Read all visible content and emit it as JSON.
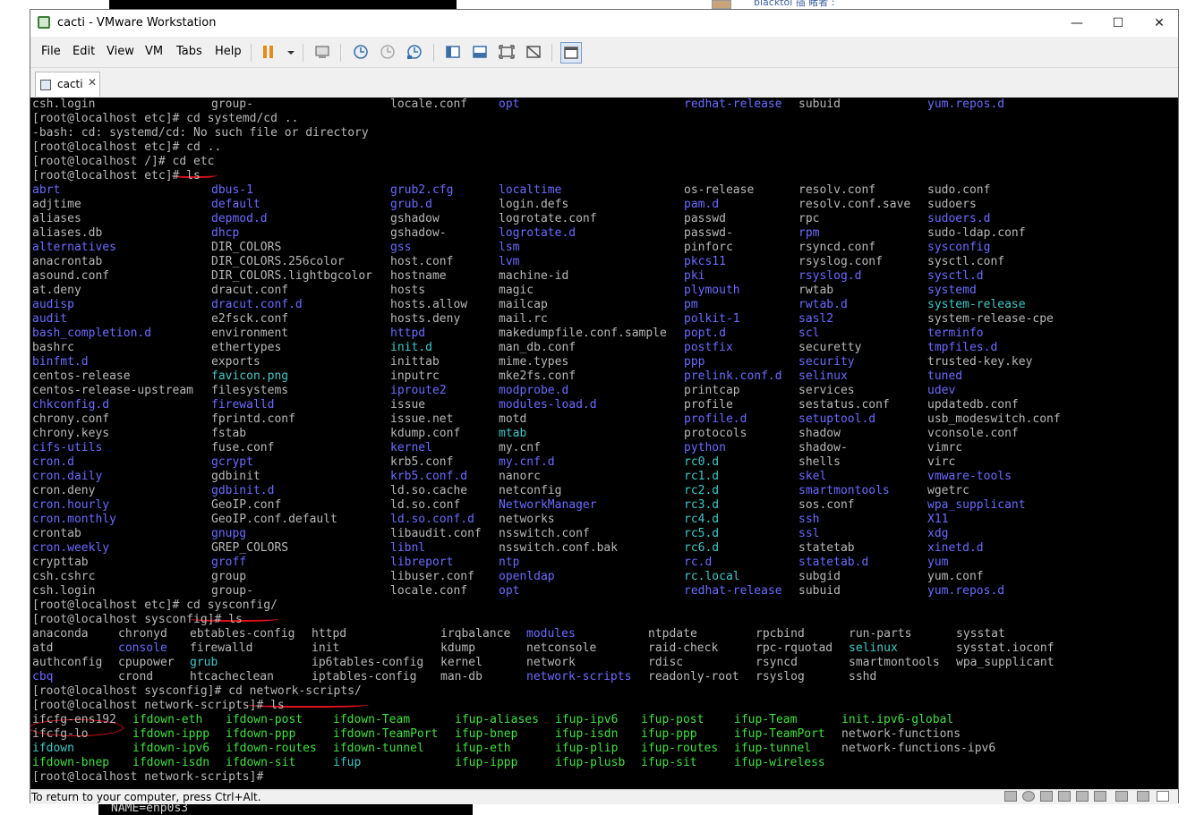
{
  "window": {
    "title": "cacti - VMware Workstation"
  },
  "background": {
    "bottom_text": "NAME=enp0s3",
    "top_text": "blacktol 插 睹者 :"
  },
  "menu": [
    "File",
    "Edit",
    "View",
    "VM",
    "Tabs",
    "Help"
  ],
  "toolbar": [
    "pause-icon",
    "dropdown-icon",
    "send-ctrl-alt-del-icon",
    "snapshot-take-icon",
    "snapshot-revert-icon",
    "snapshot-manager-icon",
    "library-icon",
    "console-view-icon",
    "fullscreen-icon",
    "unity-icon",
    "thumbnail-icon"
  ],
  "tab": {
    "label": "cacti"
  },
  "status": {
    "message": "To return to your computer, press Ctrl+Alt."
  },
  "colors": {
    "normal": "#b8b8b8",
    "dir": "#6b6bff",
    "exec": "#40e040",
    "link": "#40c8c8"
  },
  "terminal": {
    "col_pos1": [
      0,
      200,
      400,
      521,
      728,
      856,
      1000
    ],
    "row1": [
      [
        "csh.login",
        "n"
      ],
      [
        "group-",
        "n"
      ],
      [
        "locale.conf",
        "n"
      ],
      [
        "opt",
        "d"
      ],
      [
        "redhat-release",
        "d"
      ],
      [
        "subuid",
        "n"
      ],
      [
        "yum.repos.d",
        "d"
      ]
    ],
    "cmd1": [
      "[root@localhost etc]# cd systemd/cd ..",
      "-bash: cd: systemd/cd: No such file or directory",
      "[root@localhost etc]# cd ..",
      "[root@localhost /]# cd etc",
      "[root@localhost etc]# ls"
    ],
    "etc_rows": [
      [
        [
          "abrt",
          "d"
        ],
        [
          "dbus-1",
          "d"
        ],
        [
          "grub2.cfg",
          "d"
        ],
        [
          "localtime",
          "d"
        ],
        [
          "os-release",
          "n"
        ],
        [
          "resolv.conf",
          "n"
        ],
        [
          "sudo.conf",
          "n"
        ]
      ],
      [
        [
          "adjtime",
          "n"
        ],
        [
          "default",
          "d"
        ],
        [
          "grub.d",
          "d"
        ],
        [
          "login.defs",
          "n"
        ],
        [
          "pam.d",
          "d"
        ],
        [
          "resolv.conf.save",
          "n"
        ],
        [
          "sudoers",
          "n"
        ]
      ],
      [
        [
          "aliases",
          "n"
        ],
        [
          "depmod.d",
          "d"
        ],
        [
          "gshadow",
          "n"
        ],
        [
          "logrotate.conf",
          "n"
        ],
        [
          "passwd",
          "n"
        ],
        [
          "rpc",
          "n"
        ],
        [
          "sudoers.d",
          "d"
        ]
      ],
      [
        [
          "aliases.db",
          "n"
        ],
        [
          "dhcp",
          "d"
        ],
        [
          "gshadow-",
          "n"
        ],
        [
          "logrotate.d",
          "d"
        ],
        [
          "passwd-",
          "n"
        ],
        [
          "rpm",
          "d"
        ],
        [
          "sudo-ldap.conf",
          "n"
        ]
      ],
      [
        [
          "alternatives",
          "d"
        ],
        [
          "DIR_COLORS",
          "n"
        ],
        [
          "gss",
          "d"
        ],
        [
          "lsm",
          "d"
        ],
        [
          "pinforc",
          "n"
        ],
        [
          "rsyncd.conf",
          "n"
        ],
        [
          "sysconfig",
          "d"
        ]
      ],
      [
        [
          "anacrontab",
          "n"
        ],
        [
          "DIR_COLORS.256color",
          "n"
        ],
        [
          "host.conf",
          "n"
        ],
        [
          "lvm",
          "d"
        ],
        [
          "pkcs11",
          "d"
        ],
        [
          "rsyslog.conf",
          "n"
        ],
        [
          "sysctl.conf",
          "n"
        ]
      ],
      [
        [
          "asound.conf",
          "n"
        ],
        [
          "DIR_COLORS.lightbgcolor",
          "n"
        ],
        [
          "hostname",
          "n"
        ],
        [
          "machine-id",
          "n"
        ],
        [
          "pki",
          "d"
        ],
        [
          "rsyslog.d",
          "d"
        ],
        [
          "sysctl.d",
          "d"
        ]
      ],
      [
        [
          "at.deny",
          "n"
        ],
        [
          "dracut.conf",
          "n"
        ],
        [
          "hosts",
          "n"
        ],
        [
          "magic",
          "n"
        ],
        [
          "plymouth",
          "d"
        ],
        [
          "rwtab",
          "n"
        ],
        [
          "systemd",
          "d"
        ]
      ],
      [
        [
          "audisp",
          "d"
        ],
        [
          "dracut.conf.d",
          "d"
        ],
        [
          "hosts.allow",
          "n"
        ],
        [
          "mailcap",
          "n"
        ],
        [
          "pm",
          "d"
        ],
        [
          "rwtab.d",
          "d"
        ],
        [
          "system-release",
          "l"
        ]
      ],
      [
        [
          "audit",
          "d"
        ],
        [
          "e2fsck.conf",
          "n"
        ],
        [
          "hosts.deny",
          "n"
        ],
        [
          "mail.rc",
          "n"
        ],
        [
          "polkit-1",
          "d"
        ],
        [
          "sasl2",
          "d"
        ],
        [
          "system-release-cpe",
          "n"
        ]
      ],
      [
        [
          "bash_completion.d",
          "d"
        ],
        [
          "environment",
          "n"
        ],
        [
          "httpd",
          "d"
        ],
        [
          "makedumpfile.conf.sample",
          "n"
        ],
        [
          "popt.d",
          "d"
        ],
        [
          "scl",
          "d"
        ],
        [
          "terminfo",
          "d"
        ]
      ],
      [
        [
          "bashrc",
          "n"
        ],
        [
          "ethertypes",
          "n"
        ],
        [
          "init.d",
          "l"
        ],
        [
          "man_db.conf",
          "n"
        ],
        [
          "postfix",
          "d"
        ],
        [
          "securetty",
          "n"
        ],
        [
          "tmpfiles.d",
          "d"
        ]
      ],
      [
        [
          "binfmt.d",
          "d"
        ],
        [
          "exports",
          "n"
        ],
        [
          "inittab",
          "n"
        ],
        [
          "mime.types",
          "n"
        ],
        [
          "ppp",
          "d"
        ],
        [
          "security",
          "d"
        ],
        [
          "trusted-key.key",
          "n"
        ]
      ],
      [
        [
          "centos-release",
          "n"
        ],
        [
          "favicon.png",
          "l"
        ],
        [
          "inputrc",
          "n"
        ],
        [
          "mke2fs.conf",
          "n"
        ],
        [
          "prelink.conf.d",
          "d"
        ],
        [
          "selinux",
          "d"
        ],
        [
          "tuned",
          "d"
        ]
      ],
      [
        [
          "centos-release-upstream",
          "n"
        ],
        [
          "filesystems",
          "n"
        ],
        [
          "iproute2",
          "d"
        ],
        [
          "modprobe.d",
          "d"
        ],
        [
          "printcap",
          "n"
        ],
        [
          "services",
          "n"
        ],
        [
          "udev",
          "d"
        ]
      ],
      [
        [
          "chkconfig.d",
          "d"
        ],
        [
          "firewalld",
          "d"
        ],
        [
          "issue",
          "n"
        ],
        [
          "modules-load.d",
          "d"
        ],
        [
          "profile",
          "n"
        ],
        [
          "sestatus.conf",
          "n"
        ],
        [
          "updatedb.conf",
          "n"
        ]
      ],
      [
        [
          "chrony.conf",
          "n"
        ],
        [
          "fprintd.conf",
          "n"
        ],
        [
          "issue.net",
          "n"
        ],
        [
          "motd",
          "n"
        ],
        [
          "profile.d",
          "d"
        ],
        [
          "setuptool.d",
          "d"
        ],
        [
          "usb_modeswitch.conf",
          "n"
        ]
      ],
      [
        [
          "chrony.keys",
          "n"
        ],
        [
          "fstab",
          "n"
        ],
        [
          "kdump.conf",
          "n"
        ],
        [
          "mtab",
          "l"
        ],
        [
          "protocols",
          "n"
        ],
        [
          "shadow",
          "n"
        ],
        [
          "vconsole.conf",
          "n"
        ]
      ],
      [
        [
          "cifs-utils",
          "d"
        ],
        [
          "fuse.conf",
          "n"
        ],
        [
          "kernel",
          "d"
        ],
        [
          "my.cnf",
          "n"
        ],
        [
          "python",
          "d"
        ],
        [
          "shadow-",
          "n"
        ],
        [
          "vimrc",
          "n"
        ]
      ],
      [
        [
          "cron.d",
          "d"
        ],
        [
          "gcrypt",
          "d"
        ],
        [
          "krb5.conf",
          "n"
        ],
        [
          "my.cnf.d",
          "d"
        ],
        [
          "rc0.d",
          "l"
        ],
        [
          "shells",
          "n"
        ],
        [
          "virc",
          "n"
        ]
      ],
      [
        [
          "cron.daily",
          "d"
        ],
        [
          "gdbinit",
          "n"
        ],
        [
          "krb5.conf.d",
          "d"
        ],
        [
          "nanorc",
          "n"
        ],
        [
          "rc1.d",
          "l"
        ],
        [
          "skel",
          "d"
        ],
        [
          "vmware-tools",
          "d"
        ]
      ],
      [
        [
          "cron.deny",
          "n"
        ],
        [
          "gdbinit.d",
          "d"
        ],
        [
          "ld.so.cache",
          "n"
        ],
        [
          "netconfig",
          "n"
        ],
        [
          "rc2.d",
          "l"
        ],
        [
          "smartmontools",
          "d"
        ],
        [
          "wgetrc",
          "n"
        ]
      ],
      [
        [
          "cron.hourly",
          "d"
        ],
        [
          "GeoIP.conf",
          "n"
        ],
        [
          "ld.so.conf",
          "n"
        ],
        [
          "NetworkManager",
          "d"
        ],
        [
          "rc3.d",
          "l"
        ],
        [
          "sos.conf",
          "n"
        ],
        [
          "wpa_supplicant",
          "d"
        ]
      ],
      [
        [
          "cron.monthly",
          "d"
        ],
        [
          "GeoIP.conf.default",
          "n"
        ],
        [
          "ld.so.conf.d",
          "d"
        ],
        [
          "networks",
          "n"
        ],
        [
          "rc4.d",
          "l"
        ],
        [
          "ssh",
          "d"
        ],
        [
          "X11",
          "d"
        ]
      ],
      [
        [
          "crontab",
          "n"
        ],
        [
          "gnupg",
          "d"
        ],
        [
          "libaudit.conf",
          "n"
        ],
        [
          "nsswitch.conf",
          "n"
        ],
        [
          "rc5.d",
          "l"
        ],
        [
          "ssl",
          "d"
        ],
        [
          "xdg",
          "d"
        ]
      ],
      [
        [
          "cron.weekly",
          "d"
        ],
        [
          "GREP_COLORS",
          "n"
        ],
        [
          "libnl",
          "d"
        ],
        [
          "nsswitch.conf.bak",
          "n"
        ],
        [
          "rc6.d",
          "l"
        ],
        [
          "statetab",
          "n"
        ],
        [
          "xinetd.d",
          "d"
        ]
      ],
      [
        [
          "crypttab",
          "n"
        ],
        [
          "groff",
          "d"
        ],
        [
          "libreport",
          "d"
        ],
        [
          "ntp",
          "d"
        ],
        [
          "rc.d",
          "d"
        ],
        [
          "statetab.d",
          "d"
        ],
        [
          "yum",
          "d"
        ]
      ],
      [
        [
          "csh.cshrc",
          "n"
        ],
        [
          "group",
          "n"
        ],
        [
          "libuser.conf",
          "n"
        ],
        [
          "openldap",
          "d"
        ],
        [
          "rc.local",
          "l"
        ],
        [
          "subgid",
          "n"
        ],
        [
          "yum.conf",
          "n"
        ]
      ],
      [
        [
          "csh.login",
          "n"
        ],
        [
          "group-",
          "n"
        ],
        [
          "locale.conf",
          "n"
        ],
        [
          "opt",
          "d"
        ],
        [
          "redhat-release",
          "d"
        ],
        [
          "subuid",
          "n"
        ],
        [
          "yum.repos.d",
          "d"
        ]
      ]
    ],
    "cmd2": [
      "[root@localhost etc]# cd sysconfig/",
      "[root@localhost sysconfig]# ls"
    ],
    "sys_pos": [
      0,
      96,
      176,
      312,
      456,
      552,
      688,
      808,
      912,
      1032
    ],
    "sys_rows": [
      [
        [
          "anaconda",
          "n"
        ],
        [
          "chronyd",
          "n"
        ],
        [
          "ebtables-config",
          "n"
        ],
        [
          "httpd",
          "n"
        ],
        [
          "irqbalance",
          "n"
        ],
        [
          "modules",
          "d"
        ],
        [
          "ntpdate",
          "n"
        ],
        [
          "rpcbind",
          "n"
        ],
        [
          "run-parts",
          "n"
        ],
        [
          "sysstat",
          "n"
        ]
      ],
      [
        [
          "atd",
          "n"
        ],
        [
          "console",
          "d"
        ],
        [
          "firewalld",
          "n"
        ],
        [
          "init",
          "n"
        ],
        [
          "kdump",
          "n"
        ],
        [
          "netconsole",
          "n"
        ],
        [
          "raid-check",
          "n"
        ],
        [
          "rpc-rquotad",
          "n"
        ],
        [
          "selinux",
          "l"
        ],
        [
          "sysstat.ioconf",
          "n"
        ]
      ],
      [
        [
          "authconfig",
          "n"
        ],
        [
          "cpupower",
          "n"
        ],
        [
          "grub",
          "l"
        ],
        [
          "ip6tables-config",
          "n"
        ],
        [
          "kernel",
          "n"
        ],
        [
          "network",
          "n"
        ],
        [
          "rdisc",
          "n"
        ],
        [
          "rsyncd",
          "n"
        ],
        [
          "smartmontools",
          "n"
        ],
        [
          "wpa_supplicant",
          "n"
        ]
      ],
      [
        [
          "cbq",
          "d"
        ],
        [
          "crond",
          "n"
        ],
        [
          "htcacheclean",
          "n"
        ],
        [
          "iptables-config",
          "n"
        ],
        [
          "man-db",
          "n"
        ],
        [
          "network-scripts",
          "d"
        ],
        [
          "readonly-root",
          "n"
        ],
        [
          "rsyslog",
          "n"
        ],
        [
          "sshd",
          "n"
        ],
        [
          "",
          "n"
        ]
      ]
    ],
    "cmd3": [
      "[root@localhost sysconfig]# cd network-scripts/",
      "[root@localhost network-scripts]# ls"
    ],
    "net_pos": [
      0,
      112,
      216,
      336,
      472,
      584,
      680,
      784,
      904
    ],
    "net_rows": [
      [
        [
          "ifcfg-ens192",
          "n"
        ],
        [
          "ifdown-eth",
          "x"
        ],
        [
          "ifdown-post",
          "x"
        ],
        [
          "ifdown-Team",
          "x"
        ],
        [
          "ifup-aliases",
          "x"
        ],
        [
          "ifup-ipv6",
          "x"
        ],
        [
          "ifup-post",
          "x"
        ],
        [
          "ifup-Team",
          "x"
        ],
        [
          "init.ipv6-global",
          "x"
        ]
      ],
      [
        [
          "ifcfg-lo",
          "n"
        ],
        [
          "ifdown-ippp",
          "x"
        ],
        [
          "ifdown-ppp",
          "x"
        ],
        [
          "ifdown-TeamPort",
          "x"
        ],
        [
          "ifup-bnep",
          "x"
        ],
        [
          "ifup-isdn",
          "x"
        ],
        [
          "ifup-ppp",
          "x"
        ],
        [
          "ifup-TeamPort",
          "x"
        ],
        [
          "network-functions",
          "n"
        ]
      ],
      [
        [
          "ifdown",
          "l"
        ],
        [
          "ifdown-ipv6",
          "x"
        ],
        [
          "ifdown-routes",
          "x"
        ],
        [
          "ifdown-tunnel",
          "x"
        ],
        [
          "ifup-eth",
          "x"
        ],
        [
          "ifup-plip",
          "x"
        ],
        [
          "ifup-routes",
          "x"
        ],
        [
          "ifup-tunnel",
          "x"
        ],
        [
          "network-functions-ipv6",
          "n"
        ]
      ],
      [
        [
          "ifdown-bnep",
          "x"
        ],
        [
          "ifdown-isdn",
          "x"
        ],
        [
          "ifdown-sit",
          "x"
        ],
        [
          "ifup",
          "l"
        ],
        [
          "ifup-ippp",
          "x"
        ],
        [
          "ifup-plusb",
          "x"
        ],
        [
          "ifup-sit",
          "x"
        ],
        [
          "ifup-wireless",
          "x"
        ],
        [
          "",
          "n"
        ]
      ]
    ],
    "final_prompt": "[root@localhost network-scripts]# "
  }
}
